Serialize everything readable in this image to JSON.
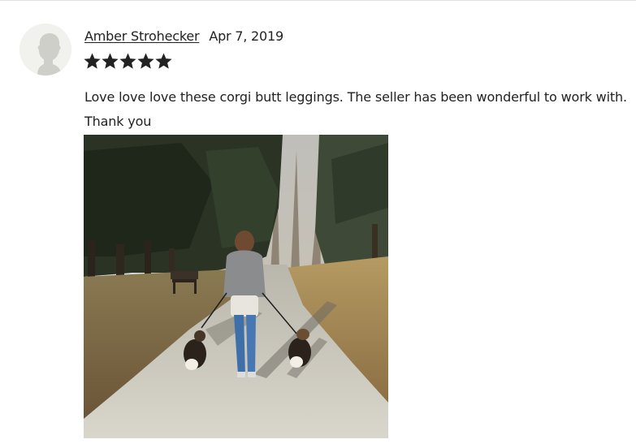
{
  "review": {
    "reviewer_name": "Amber Strohecker",
    "date": "Apr 7, 2019",
    "rating": 5,
    "rating_max": 5,
    "text": "Love love love these corgi butt leggings. The seller has been wonderful to work with. Thank you"
  },
  "icons": {
    "avatar": "default-user-avatar-icon",
    "star": "filled-star-icon"
  },
  "colors": {
    "text": "#222222",
    "star": "#222222",
    "avatar_bg": "#f1f1ed",
    "avatar_silhouette": "#cfcfca",
    "divider": "#e1e1e1"
  }
}
